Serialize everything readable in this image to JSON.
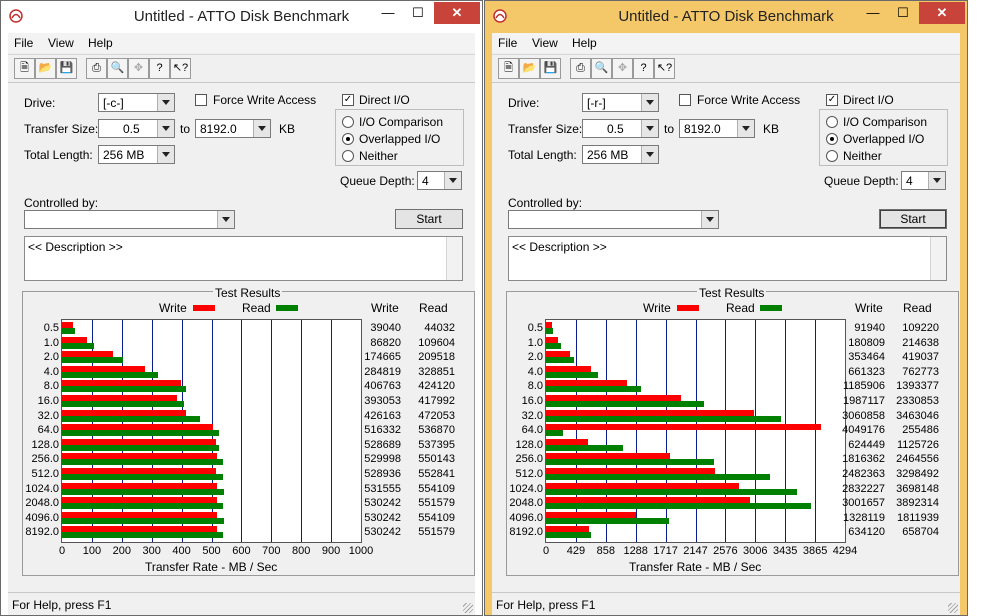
{
  "windows": [
    {
      "title": "Untitled - ATTO Disk Benchmark",
      "frame_color": "#ffffff",
      "menu": [
        "File",
        "View",
        "Help"
      ],
      "form": {
        "drive_label": "Drive:",
        "drive_value": "[-c-]",
        "transfer_label": "Transfer Size:",
        "transfer_from": "0.5",
        "to_label": "to",
        "transfer_to": "8192.0",
        "kb_label": "KB",
        "length_label": "Total Length:",
        "length_value": "256 MB",
        "force_write": "Force Write Access",
        "force_write_checked": false,
        "direct_io": "Direct I/O",
        "direct_io_checked": true,
        "io_comparison": "I/O Comparison",
        "overlapped_io": "Overlapped I/O",
        "neither": "Neither",
        "selected_io": "overlapped",
        "queue_label": "Queue Depth:",
        "queue_value": "4",
        "controlled_label": "Controlled by:",
        "controlled_value": "",
        "start_label": "Start",
        "start_focused": false,
        "description": "<< Description >>"
      },
      "results": {
        "title": "Test Results",
        "legend_write": "Write",
        "legend_read": "Read",
        "col_write": "Write",
        "col_read": "Read",
        "x_axis_label": "Transfer Rate - MB / Sec",
        "x_max": 1000,
        "x_ticks": [
          "0",
          "100",
          "200",
          "300",
          "400",
          "500",
          "600",
          "700",
          "800",
          "900",
          "1000"
        ],
        "sizes": [
          "0.5",
          "1.0",
          "2.0",
          "4.0",
          "8.0",
          "16.0",
          "32.0",
          "64.0",
          "128.0",
          "256.0",
          "512.0",
          "1024.0",
          "2048.0",
          "4096.0",
          "8192.0"
        ],
        "write_kbs": [
          39040,
          86820,
          174665,
          284819,
          406763,
          393053,
          426163,
          516332,
          528689,
          529998,
          528936,
          531555,
          530242,
          530242,
          530242
        ],
        "read_kbs": [
          44032,
          109604,
          209518,
          328851,
          424120,
          417992,
          472053,
          536870,
          537395,
          550143,
          552841,
          554109,
          551579,
          554109,
          551579
        ],
        "write_text": [
          "39040",
          "86820",
          "174665",
          "284819",
          "406763",
          "393053",
          "426163",
          "516332",
          "528689",
          "529998",
          "528936",
          "531555",
          "530242",
          "530242",
          "530242"
        ],
        "read_text": [
          "44032",
          "109604",
          "209518",
          "328851",
          "424120",
          "417992",
          "472053",
          "536870",
          "537395",
          "550143",
          "552841",
          "554109",
          "551579",
          "554109",
          "551579"
        ]
      },
      "status": "For Help, press F1"
    },
    {
      "title": "Untitled - ATTO Disk Benchmark",
      "frame_color": "#f4c869",
      "menu": [
        "File",
        "View",
        "Help"
      ],
      "form": {
        "drive_label": "Drive:",
        "drive_value": "[-r-]",
        "transfer_label": "Transfer Size:",
        "transfer_from": "0.5",
        "to_label": "to",
        "transfer_to": "8192.0",
        "kb_label": "KB",
        "length_label": "Total Length:",
        "length_value": "256 MB",
        "force_write": "Force Write Access",
        "force_write_checked": false,
        "direct_io": "Direct I/O",
        "direct_io_checked": true,
        "io_comparison": "I/O Comparison",
        "overlapped_io": "Overlapped I/O",
        "neither": "Neither",
        "selected_io": "overlapped",
        "queue_label": "Queue Depth:",
        "queue_value": "4",
        "controlled_label": "Controlled by:",
        "controlled_value": "",
        "start_label": "Start",
        "start_focused": true,
        "description": "<< Description >>"
      },
      "results": {
        "title": "Test Results",
        "legend_write": "Write",
        "legend_read": "Read",
        "col_write": "Write",
        "col_read": "Read",
        "x_axis_label": "Transfer Rate - MB / Sec",
        "x_max": 4294,
        "x_ticks": [
          "0",
          "429",
          "858",
          "1288",
          "1717",
          "2147",
          "2576",
          "3006",
          "3435",
          "3865",
          "4294"
        ],
        "sizes": [
          "0.5",
          "1.0",
          "2.0",
          "4.0",
          "8.0",
          "16.0",
          "32.0",
          "64.0",
          "128.0",
          "256.0",
          "512.0",
          "1024.0",
          "2048.0",
          "4096.0",
          "8192.0"
        ],
        "write_kbs": [
          91940,
          180809,
          353464,
          661323,
          1185906,
          1987117,
          3060858,
          4049176,
          624449,
          1816362,
          2482363,
          2832227,
          3001657,
          1328119,
          634120
        ],
        "read_kbs": [
          109220,
          214638,
          419037,
          762773,
          1393377,
          2330853,
          3463046,
          255486,
          1125726,
          2464556,
          3298492,
          3698148,
          3892314,
          1811939,
          658704
        ],
        "write_text": [
          "91940",
          "180809",
          "353464",
          "661323",
          "1185906",
          "1987117",
          "3060858",
          "4049176",
          "624449",
          "1816362",
          "2482363",
          "2832227",
          "3001657",
          "1328119",
          "634120"
        ],
        "read_text": [
          "109220",
          "214638",
          "419037",
          "762773",
          "1393377",
          "2330853",
          "3463046",
          "255486",
          "1125726",
          "2464556",
          "3298492",
          "3698148",
          "3892314",
          "1811939",
          "658704"
        ]
      },
      "status": "For Help, press F1"
    }
  ],
  "chart_data": [
    {
      "type": "bar",
      "title": "Test Results",
      "xlabel": "Transfer Rate - MB / Sec",
      "ylabel": "",
      "categories": [
        "0.5",
        "1.0",
        "2.0",
        "4.0",
        "8.0",
        "16.0",
        "32.0",
        "64.0",
        "128.0",
        "256.0",
        "512.0",
        "1024.0",
        "2048.0",
        "4096.0",
        "8192.0"
      ],
      "series": [
        {
          "name": "Write",
          "color": "#ff0000",
          "values": [
            39040,
            86820,
            174665,
            284819,
            406763,
            393053,
            426163,
            516332,
            528689,
            529998,
            528936,
            531555,
            530242,
            530242,
            530242
          ]
        },
        {
          "name": "Read",
          "color": "#008000",
          "values": [
            44032,
            109604,
            209518,
            328851,
            424120,
            417992,
            472053,
            536870,
            537395,
            550143,
            552841,
            554109,
            551579,
            554109,
            551579
          ]
        }
      ],
      "xlim": [
        0,
        1000
      ],
      "orientation": "horizontal",
      "grid": true,
      "legend": "top"
    },
    {
      "type": "bar",
      "title": "Test Results",
      "xlabel": "Transfer Rate - MB / Sec",
      "ylabel": "",
      "categories": [
        "0.5",
        "1.0",
        "2.0",
        "4.0",
        "8.0",
        "16.0",
        "32.0",
        "64.0",
        "128.0",
        "256.0",
        "512.0",
        "1024.0",
        "2048.0",
        "4096.0",
        "8192.0"
      ],
      "series": [
        {
          "name": "Write",
          "color": "#ff0000",
          "values": [
            91940,
            180809,
            353464,
            661323,
            1185906,
            1987117,
            3060858,
            4049176,
            624449,
            1816362,
            2482363,
            2832227,
            3001657,
            1328119,
            634120
          ]
        },
        {
          "name": "Read",
          "color": "#008000",
          "values": [
            109220,
            214638,
            419037,
            762773,
            1393377,
            2330853,
            3463046,
            255486,
            1125726,
            2464556,
            3298492,
            3698148,
            3892314,
            1811939,
            658704
          ]
        }
      ],
      "xlim": [
        0,
        4294
      ],
      "orientation": "horizontal",
      "grid": true,
      "legend": "top"
    }
  ]
}
